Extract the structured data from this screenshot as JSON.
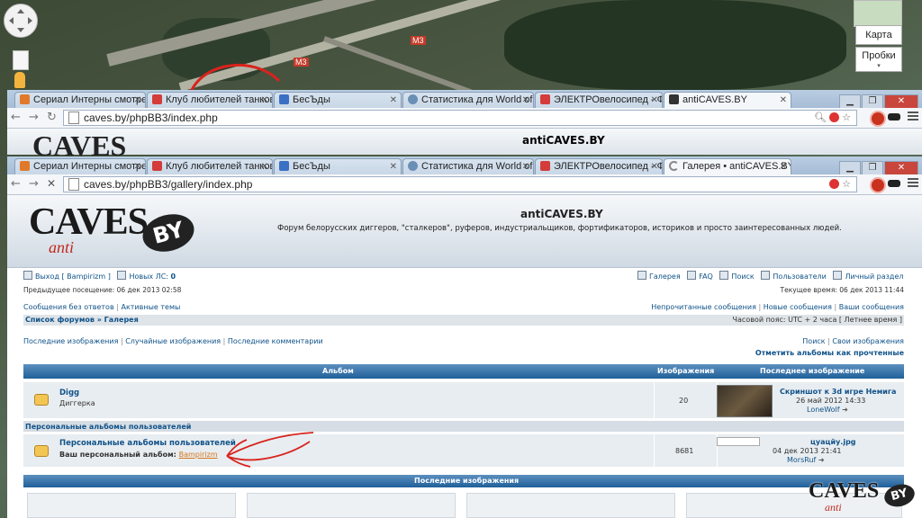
{
  "map": {
    "view_button": "Карта",
    "traffic_button": "Пробки",
    "road_label": "М3",
    "road_label_2": "M3"
  },
  "back_window": {
    "tabs": [
      {
        "label": "Сериал Интерны смотре",
        "favicon_color": "#e07a2a"
      },
      {
        "label": "Клуб любителей танков",
        "favicon_color": "#d43b3b"
      },
      {
        "label": "БесЪды",
        "favicon_color": "#3a6fc4"
      },
      {
        "label": "Статистика для World of",
        "favicon_color": "#6a8fb5"
      },
      {
        "label": "ЭЛЕКТРОвелосипед - Фо",
        "favicon_color": "#d43b3b"
      },
      {
        "label": "antiCAVES.BY",
        "favicon_color": "#333333"
      }
    ],
    "url": "caves.by/phpBB3/index.php",
    "site_title": "antiCAVES.BY"
  },
  "front_window": {
    "tabs": [
      {
        "label": "Сериал Интерны смотре",
        "favicon_color": "#e07a2a"
      },
      {
        "label": "Клуб любителей танков",
        "favicon_color": "#d43b3b"
      },
      {
        "label": "БесЪды",
        "favicon_color": "#3a6fc4"
      },
      {
        "label": "Статистика для World of",
        "favicon_color": "#6a8fb5"
      },
      {
        "label": "ЭЛЕКТРОвелосипед - Фо",
        "favicon_color": "#d43b3b"
      },
      {
        "label": "Галерея • antiCAVES.BY",
        "favicon_color": "#888888"
      }
    ],
    "url": "caves.by/phpBB3/gallery/index.php"
  },
  "forum": {
    "logo": {
      "word": "CAVES",
      "badge": "BY",
      "sub": "anti"
    },
    "title": "antiCAVES.BY",
    "description": "Форум белорусских диггеров, \"сталкеров\", руферов, индустриальщиков, фортификаторов, историков и просто заинтересованных людей.",
    "logout": "Выход [ Bampirizm ]",
    "new_pm": "Новых ЛС: ",
    "new_pm_count": "0",
    "top_links": [
      "Галерея",
      "FAQ",
      "Поиск",
      "Пользователи",
      "Личный раздел"
    ],
    "last_visit": "Предыдущее посещение: 06 дек 2013 02:58",
    "current_time": "Текущее время: 06 дек 2013 11:44",
    "left_links": [
      "Сообщения без ответов",
      "Активные темы"
    ],
    "right_links": [
      "Непрочитанные сообщения",
      "Новые сообщения",
      "Ваши сообщения"
    ],
    "breadcrumb": "Список форумов » Галерея",
    "timezone": "Часовой пояс: UTC + 2 часа [ Летнее время ]",
    "gallery_links": [
      "Последние изображения",
      "Случайные изображения",
      "Последние комментарии"
    ],
    "gallery_right_links": [
      "Поиск",
      "Свои изображения"
    ],
    "mark_read": "Отметить альбомы как прочтенные",
    "table_headers": {
      "album": "Альбом",
      "images": "Изображения",
      "last_image": "Последнее изображение"
    },
    "albums": [
      {
        "name": "Digg",
        "desc": "Диггерка",
        "count": "20",
        "last_title": "Скриншот к 3d игре Немига",
        "last_date": "26 май 2012 14:33",
        "last_user": "LoneWolf"
      }
    ],
    "personal_section": "Персональные альбомы пользователей",
    "personal": {
      "name": "Персональные альбомы пользователей",
      "own_label": "Ваш персональный альбом: ",
      "own_link": "Bampirizm",
      "count": "8681",
      "last_title": "цуацйу.jpg",
      "last_date": "04 дек 2013 21:41",
      "last_user": "MorsRuf"
    },
    "recent_header": "Последние изображения"
  },
  "watermark": {
    "word": "CAVES",
    "badge": "BY",
    "sub": "anti"
  },
  "colors": {
    "link": "#105289",
    "header_blue": "#1f5f99",
    "annotation_red": "#d8231c",
    "personal_link": "#d6761a"
  }
}
